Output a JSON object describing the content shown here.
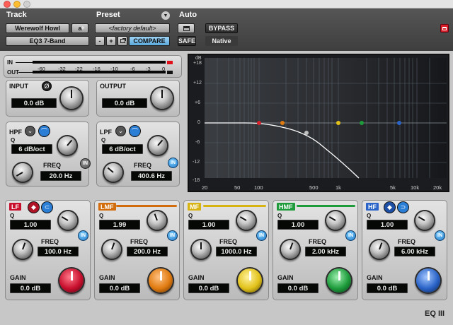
{
  "header": {
    "track_label": "Track",
    "preset_label": "Preset",
    "auto_label": "Auto",
    "track_name": "Werewolf Howl",
    "track_channel": "a",
    "plugin_name": "EQ3 7-Band",
    "preset_name": "<factory default>",
    "minus_label": "-",
    "plus_label": "+",
    "compare_label": "COMPARE",
    "safe_label": "SAFE",
    "bypass_label": "BYPASS",
    "native_label": "Native"
  },
  "meters": {
    "in_label": "IN",
    "out_label": "OUT",
    "scale": [
      "-60",
      "-32",
      "-22",
      "-16",
      "-10",
      "-6",
      "-3",
      "0"
    ]
  },
  "input": {
    "label": "INPUT",
    "value": "0.0 dB",
    "phase_symbol": "Ø"
  },
  "output": {
    "label": "OUTPUT",
    "value": "0.0 dB"
  },
  "hpf": {
    "label": "HPF",
    "q_label": "Q",
    "q_value": "6 dB/oct",
    "freq_label": "FREQ",
    "freq_value": "20.0 Hz",
    "in_label": "IN"
  },
  "lpf": {
    "label": "LPF",
    "q_label": "Q",
    "q_value": "6 dB/oct",
    "freq_label": "FREQ",
    "freq_value": "400.6 Hz",
    "in_label": "IN"
  },
  "graph": {
    "y_labels": [
      "dB",
      "+18",
      "+12",
      "+6",
      "0",
      "-6",
      "-12",
      "-18"
    ],
    "x_labels": [
      "20",
      "50",
      "100",
      "500",
      "1k",
      "5k",
      "10k",
      "20k"
    ]
  },
  "bands": [
    {
      "label": "LF",
      "color": "#c8102e",
      "q_label": "Q",
      "q_value": "1.00",
      "freq_label": "FREQ",
      "freq_value": "100.0 Hz",
      "gain_label": "GAIN",
      "gain_value": "0.0 dB",
      "in_label": "IN"
    },
    {
      "label": "LMF",
      "color": "#e07b10",
      "q_label": "Q",
      "q_value": "1.99",
      "freq_label": "FREQ",
      "freq_value": "200.0 Hz",
      "gain_label": "GAIN",
      "gain_value": "0.0 dB",
      "in_label": "IN"
    },
    {
      "label": "MF",
      "color": "#e2c21a",
      "q_label": "Q",
      "q_value": "1.00",
      "freq_label": "FREQ",
      "freq_value": "1000.0 Hz",
      "gain_label": "GAIN",
      "gain_value": "0.0 dB",
      "in_label": "IN"
    },
    {
      "label": "HMF",
      "color": "#1e9c3c",
      "q_label": "Q",
      "q_value": "1.00",
      "freq_label": "FREQ",
      "freq_value": "2.00 kHz",
      "gain_label": "GAIN",
      "gain_value": "0.0 dB",
      "in_label": "IN"
    },
    {
      "label": "HF",
      "color": "#2a64c8",
      "q_label": "Q",
      "q_value": "1.00",
      "freq_label": "FREQ",
      "freq_value": "6.00 kHz",
      "gain_label": "GAIN",
      "gain_value": "0.0 dB",
      "in_label": "IN"
    }
  ],
  "footer": {
    "logo": "EQ III"
  }
}
